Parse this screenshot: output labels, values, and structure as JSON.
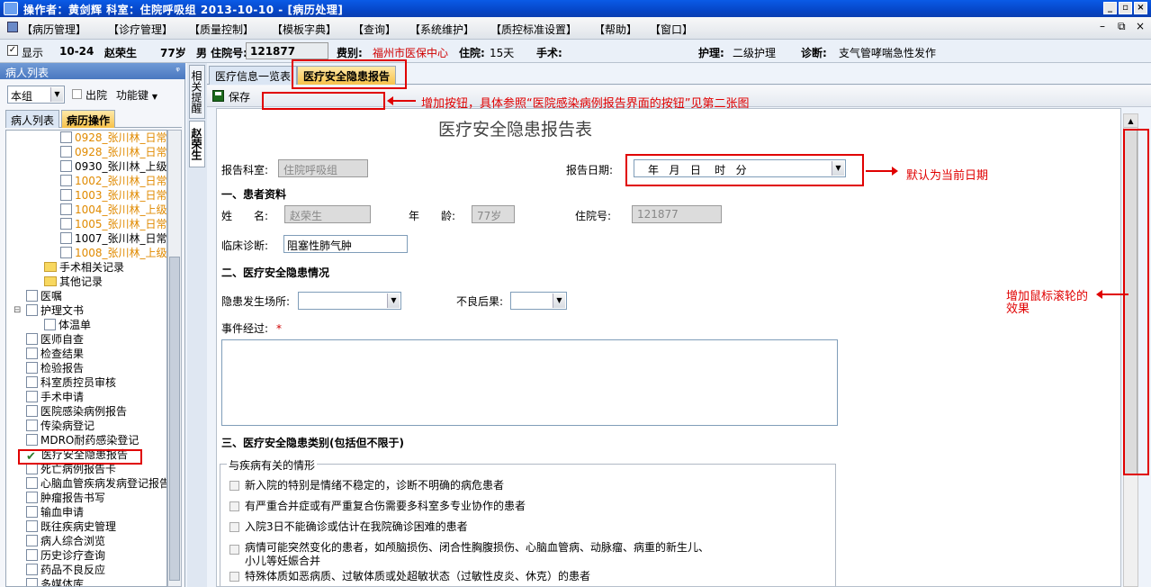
{
  "window": {
    "title": "操作者：黄剑辉  科室：住院呼吸组  2013-10-10 - [病历处理]"
  },
  "menu": [
    "【病历管理】",
    "【诊疗管理】",
    "【质量控制】",
    "【模板字典】",
    "【查询】",
    "【系统维护】",
    "【质控标准设置】",
    "【帮助】",
    "【窗口】"
  ],
  "patient": {
    "show_label": "显示",
    "date": "10-24",
    "name": "赵荣生",
    "age": "77岁",
    "gender_label": "男 住院号:",
    "admission_no": "121877",
    "fee_label": "费别:",
    "fee_value": "福州市医保中心",
    "stay_label": "住院:",
    "stay_value": "15天",
    "surgery_label": "手术:",
    "nursing_label": "护理:",
    "nursing_value": "二级护理",
    "diag_label": "诊断:",
    "diag_value": "支气管哮喘急性发作"
  },
  "left": {
    "header": "病人列表",
    "pin": "ᵠ",
    "group": "本组",
    "discharged": "出院",
    "funckey": "功能键",
    "tabs": [
      "病人列表",
      "病历操作"
    ],
    "tree": [
      {
        "label": "0928_张川林_日常",
        "orange": true,
        "indent": 60,
        "icon": "doc"
      },
      {
        "label": "0928_张川林_日常",
        "orange": true,
        "indent": 60,
        "icon": "doc"
      },
      {
        "label": "0930_张川林_上级",
        "orange": false,
        "indent": 60,
        "icon": "doc"
      },
      {
        "label": "1002_张川林_日常",
        "orange": true,
        "indent": 60,
        "icon": "doc"
      },
      {
        "label": "1003_张川林_日常",
        "orange": true,
        "indent": 60,
        "icon": "doc"
      },
      {
        "label": "1004_张川林_上级",
        "orange": true,
        "indent": 60,
        "icon": "doc"
      },
      {
        "label": "1005_张川林_日常",
        "orange": true,
        "indent": 60,
        "icon": "doc"
      },
      {
        "label": "1007_张川林_日常",
        "orange": false,
        "indent": 60,
        "icon": "doc"
      },
      {
        "label": "1008_张川林_上级",
        "orange": true,
        "indent": 60,
        "icon": "doc"
      },
      {
        "label": "手术相关记录",
        "orange": false,
        "indent": 42,
        "icon": "fold"
      },
      {
        "label": "其他记录",
        "orange": false,
        "indent": 42,
        "icon": "fold"
      },
      {
        "label": "医嘱",
        "orange": false,
        "indent": 22,
        "icon": "doc"
      },
      {
        "label": "护理文书",
        "orange": false,
        "indent": 22,
        "icon": "doc",
        "expander": "⊟"
      },
      {
        "label": "体温单",
        "orange": false,
        "indent": 42,
        "icon": "doc"
      },
      {
        "label": "医师自查",
        "orange": false,
        "indent": 22,
        "icon": "doc"
      },
      {
        "label": "检查结果",
        "orange": false,
        "indent": 22,
        "icon": "doc"
      },
      {
        "label": "检验报告",
        "orange": false,
        "indent": 22,
        "icon": "doc"
      },
      {
        "label": "科室质控员审核",
        "orange": false,
        "indent": 22,
        "icon": "doc"
      },
      {
        "label": "手术申请",
        "orange": false,
        "indent": 22,
        "icon": "doc"
      },
      {
        "label": "医院感染病例报告",
        "orange": false,
        "indent": 22,
        "icon": "doc"
      },
      {
        "label": "传染病登记",
        "orange": false,
        "indent": 22,
        "icon": "doc"
      },
      {
        "label": "MDRO耐药感染登记",
        "orange": false,
        "indent": 22,
        "icon": "doc"
      },
      {
        "label": "医疗安全隐患报告",
        "orange": false,
        "indent": 22,
        "icon": "chk"
      },
      {
        "label": "死亡病例报告卡",
        "orange": false,
        "indent": 22,
        "icon": "doc"
      },
      {
        "label": "心脑血管疾病发病登记报告",
        "orange": false,
        "indent": 22,
        "icon": "doc"
      },
      {
        "label": "肿瘤报告书写",
        "orange": false,
        "indent": 22,
        "icon": "doc"
      },
      {
        "label": "输血申请",
        "orange": false,
        "indent": 22,
        "icon": "doc"
      },
      {
        "label": "既往疾病史管理",
        "orange": false,
        "indent": 22,
        "icon": "doc"
      },
      {
        "label": "病人综合浏览",
        "orange": false,
        "indent": 22,
        "icon": "doc"
      },
      {
        "label": "历史诊疗查询",
        "orange": false,
        "indent": 22,
        "icon": "doc"
      },
      {
        "label": "药品不良反应",
        "orange": false,
        "indent": 22,
        "icon": "doc"
      },
      {
        "label": "多媒体库",
        "orange": false,
        "indent": 22,
        "icon": "doc"
      }
    ]
  },
  "sidetabs": [
    "相关提醒",
    "赵荣生"
  ],
  "content": {
    "tabs": [
      "医疗信息一览表",
      "医疗安全隐患报告"
    ],
    "save": "保存"
  },
  "form": {
    "title": "医疗安全隐患报告表",
    "dept_label": "报告科室:",
    "dept_value": "住院呼吸组",
    "date_label": "报告日期:",
    "date_value": "年   月   日    时   分",
    "sec1": "一、患者资料",
    "name_label": "姓　　名:",
    "name_value": "赵荣生",
    "age_label": "年　　龄:",
    "age_value": "77岁",
    "admno_label": "住院号:",
    "admno_value": "121877",
    "diag_label": "临床诊断:",
    "diag_value": "阻塞性肺气肿",
    "sec2": "二、医疗安全隐患情况",
    "place_label": "隐患发生场所:",
    "conseq_label": "不良后果:",
    "event_label": "事件经过:",
    "required_mark": "*",
    "sec3": "三、医疗安全隐患类别(包括但不限于)",
    "group_title": "与疾病有关的情形",
    "items": [
      "新入院的特别是情绪不稳定的，诊断不明确的病危患者",
      "有严重合并症或有严重复合伤需要多科室多专业协作的患者",
      "入院3日不能确诊或估计在我院确诊困难的患者",
      "病情可能突然变化的患者，如颅脑损伤、闭合性胸腹损伤、心脑血管病、动脉瘤、病重的新生儿、",
      "特殊体质如恶病质、过敏体质或处超敏状态（过敏性皮炎、休克）的患者"
    ],
    "item4_line2": "小儿等妊娠合并"
  },
  "annotations": {
    "add_buttons": "增加按钮，具体参照“医院感染病例报告界面的按钮”见第二张图",
    "default_date": "默认为当前日期",
    "wheel_line1": "增加鼠标滚轮的",
    "wheel_line2": "效果"
  }
}
